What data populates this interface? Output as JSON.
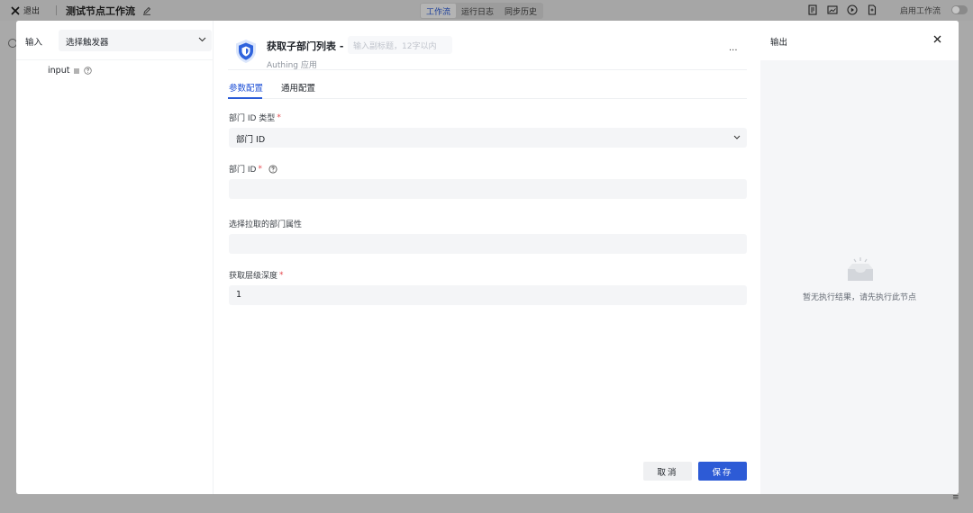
{
  "topbar": {
    "exit_label": "退出",
    "workflow_title": "测试节点工作流",
    "tabs": [
      "工作流",
      "运行日志",
      "同步历史"
    ],
    "enable_label": "启用工作流"
  },
  "left_panel": {
    "label": "输入",
    "trigger_select": "选择触发器",
    "param_name": "input"
  },
  "node": {
    "name": "获取子部门列表 -",
    "description_placeholder": "输入副标题，12字以内",
    "app": "Authing 应用",
    "more": "···",
    "tabs": [
      "参数配置",
      "通用配置"
    ],
    "fields": {
      "dept_id_type_label": "部门 ID 类型",
      "dept_id_type_value": "部门 ID",
      "dept_id_label": "部门 ID",
      "dept_id_value": "",
      "attrs_label": "选择拉取的部门属性",
      "attrs_value": "",
      "depth_label": "获取层级深度",
      "depth_value": "1"
    },
    "required_mark": "*",
    "cancel": "取消",
    "save": "保存"
  },
  "right_panel": {
    "label": "输出",
    "empty_text": "暂无执行结果，请先执行此节点"
  },
  "colors": {
    "primary": "#2d5bd6",
    "required": "#e5484d"
  }
}
